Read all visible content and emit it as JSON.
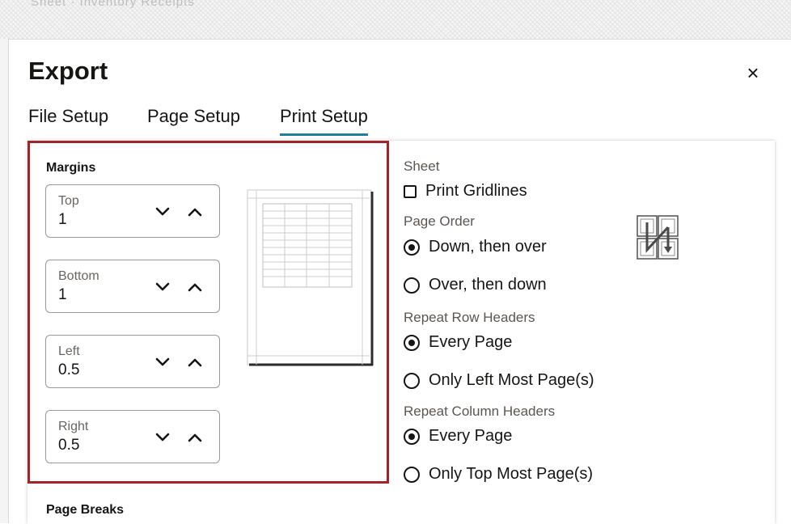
{
  "background": {
    "ghost_text": "Sheet  ·  Inventory Receipts"
  },
  "dialog": {
    "title": "Export",
    "close_glyph": "×",
    "close_icon": "close-icon"
  },
  "tabs": [
    {
      "label": "File Setup",
      "active": false
    },
    {
      "label": "Page Setup",
      "active": false
    },
    {
      "label": "Print Setup",
      "active": true
    }
  ],
  "margins": {
    "label": "Margins",
    "fields": [
      {
        "label": "Top",
        "value": "1"
      },
      {
        "label": "Bottom",
        "value": "1"
      },
      {
        "label": "Left",
        "value": "0.5"
      },
      {
        "label": "Right",
        "value": "0.5"
      }
    ],
    "decrease_icon": "chevron-down-icon",
    "increase_icon": "chevron-up-icon"
  },
  "page_breaks": {
    "label": "Page Breaks"
  },
  "sheet": {
    "label": "Sheet",
    "print_gridlines": {
      "label": "Print Gridlines",
      "checked": false
    }
  },
  "page_order": {
    "label": "Page Order",
    "options": [
      {
        "label": "Down, then over",
        "checked": true
      },
      {
        "label": "Over, then down",
        "checked": false
      }
    ],
    "icon": "page-order-icon"
  },
  "repeat_row_headers": {
    "label": "Repeat Row Headers",
    "options": [
      {
        "label": "Every Page",
        "checked": true
      },
      {
        "label": "Only Left Most Page(s)",
        "checked": false
      }
    ]
  },
  "repeat_column_headers": {
    "label": "Repeat Column Headers",
    "options": [
      {
        "label": "Every Page",
        "checked": true
      },
      {
        "label": "Only Top Most Page(s)",
        "checked": false
      }
    ]
  },
  "colors": {
    "highlight_border": "#a1242a",
    "active_tab_underline": "#227e9e",
    "text": "#161513"
  }
}
